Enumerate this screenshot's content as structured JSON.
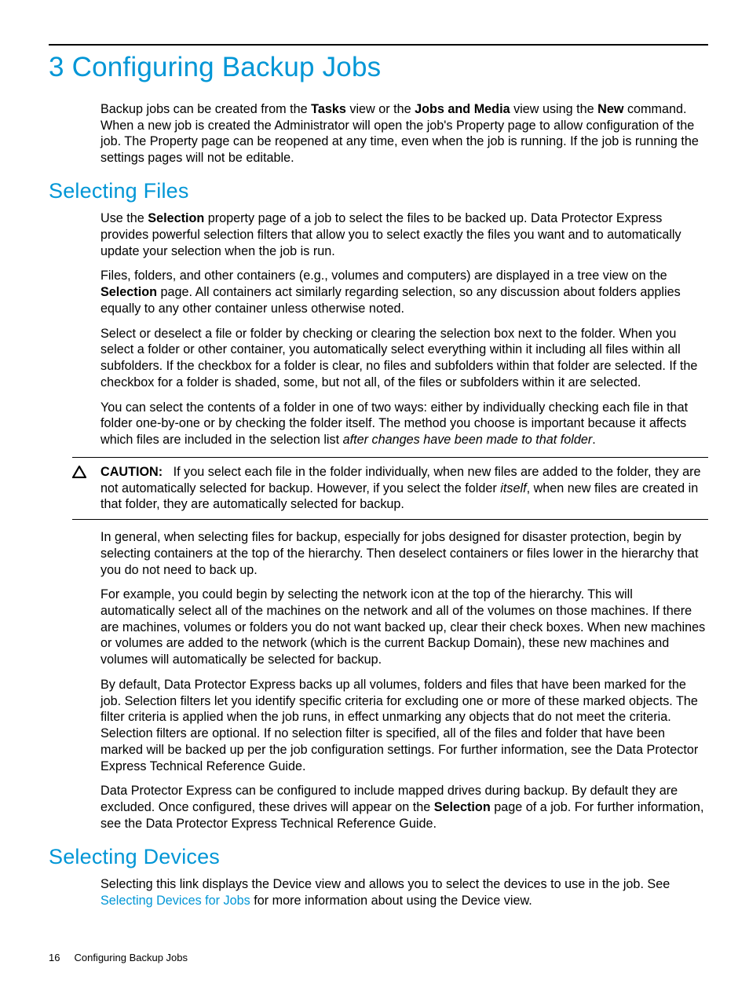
{
  "chapter": {
    "number": "3",
    "title": "Configuring Backup Jobs"
  },
  "intro": {
    "p1_a": "Backup jobs can be created from the ",
    "p1_b": "Tasks",
    "p1_c": " view or the ",
    "p1_d": "Jobs and Media",
    "p1_e": " view using the ",
    "p1_f": "New",
    "p1_g": " command. When a new job is created the Administrator will open the job's Property page to allow configuration of the job. The Property page can be reopened at any time, even when the job is running. If the job is running the settings pages will not be editable."
  },
  "sec1": {
    "heading": "Selecting Files",
    "p1_a": "Use the ",
    "p1_b": "Selection",
    "p1_c": " property page of a job to select the files to be backed up. Data Protector Express provides powerful selection filters that allow you to select exactly the files you want and to automatically update your selection when the job is run.",
    "p2_a": "Files, folders, and other containers (e.g., volumes and computers) are displayed in a tree view on the ",
    "p2_b": "Selection",
    "p2_c": " page. All containers act similarly regarding selection, so any discussion about folders applies equally to any other container unless otherwise noted.",
    "p3": "Select or deselect a file or folder by checking or clearing the selection box next to the folder. When you select a folder or other container, you automatically select everything within it including all files within all subfolders. If the checkbox for a folder is clear, no files and subfolders within that folder are selected. If the checkbox for a folder is shaded, some, but not all, of the files or subfolders within it are selected.",
    "p4_a": "You can select the contents of a folder in one of two ways: either by individually checking each file in that folder one-by-one or by checking the folder itself. The method you choose is important because it affects which files are included in the selection list ",
    "p4_b": "after changes have been made to that folder",
    "p4_c": ".",
    "caution_label": "CAUTION:",
    "caution_a": "If you select each file in the folder individually, when new files are added to the folder, they are not automatically selected for backup. However, if you select the folder ",
    "caution_b": "itself",
    "caution_c": ", when new files are created in that folder, they are automatically selected for backup.",
    "p5": "In general, when selecting files for backup, especially for jobs designed for disaster protection, begin by selecting containers at the top of the hierarchy. Then deselect containers or files lower in the hierarchy that you do not need to back up.",
    "p6": "For example, you could begin by selecting the network icon at the top of the hierarchy. This will automatically select all of the machines on the network and all of the volumes on those machines. If there are machines, volumes or folders you do not want backed up, clear their check boxes. When new machines or volumes are added to the network (which is the current Backup Domain), these new machines and volumes will automatically be selected for backup.",
    "p7": "By default, Data Protector Express backs up all volumes, folders and files that have been marked for the job. Selection filters let you identify specific criteria for excluding one or more of these marked objects. The filter criteria is applied when the job runs, in effect unmarking any objects that do not meet the criteria. Selection filters are optional. If no selection filter is specified, all of the files and folder that have been marked will be backed up per the job configuration settings. For further information, see the Data Protector Express Technical Reference Guide.",
    "p8_a": "Data Protector Express can be configured to include mapped drives during backup. By default they are excluded. Once configured, these drives will appear on the ",
    "p8_b": "Selection",
    "p8_c": " page of a job. For further information, see the Data Protector Express Technical Reference Guide."
  },
  "sec2": {
    "heading": "Selecting Devices",
    "p1_a": "Selecting this link displays the Device view and allows you to select the devices to use in the job. See ",
    "p1_link": "Selecting Devices for Jobs",
    "p1_b": " for more information about using the Device view."
  },
  "footer": {
    "page": "16",
    "title": "Configuring Backup Jobs"
  }
}
